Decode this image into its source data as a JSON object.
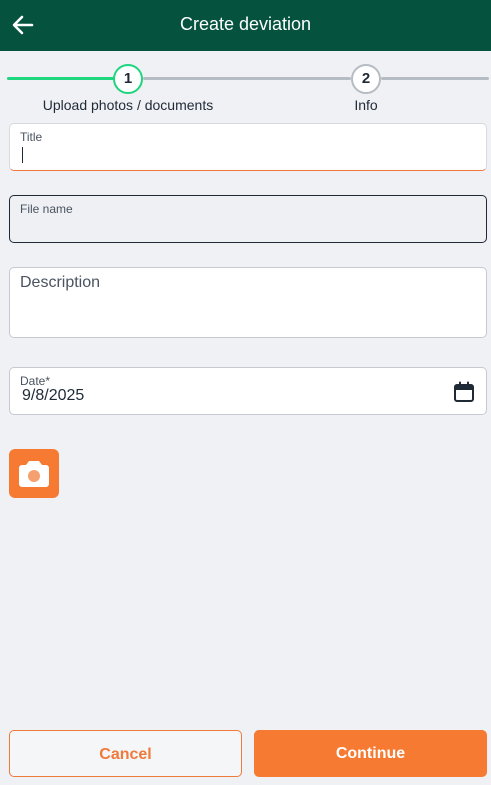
{
  "header": {
    "title": "Create deviation",
    "back_icon": "arrow-left-icon",
    "background_color": "#05533f"
  },
  "stepper": {
    "steps": [
      {
        "number": "1",
        "label": "Upload photos / documents",
        "state": "active"
      },
      {
        "number": "2",
        "label": "Info",
        "state": "inactive"
      }
    ],
    "active_color": "#1ed67e",
    "inactive_color": "#b6bcc3"
  },
  "form": {
    "title": {
      "label": "Title",
      "value": ""
    },
    "file_name": {
      "label": "File name",
      "value": ""
    },
    "description": {
      "placeholder": "Description",
      "value": ""
    },
    "date": {
      "label": "Date*",
      "value": "9/8/2025",
      "icon": "calendar-icon"
    }
  },
  "camera_button": {
    "icon": "camera-icon",
    "color": "#f67a32"
  },
  "footer": {
    "cancel_label": "Cancel",
    "continue_label": "Continue",
    "accent_color": "#f67a32"
  }
}
